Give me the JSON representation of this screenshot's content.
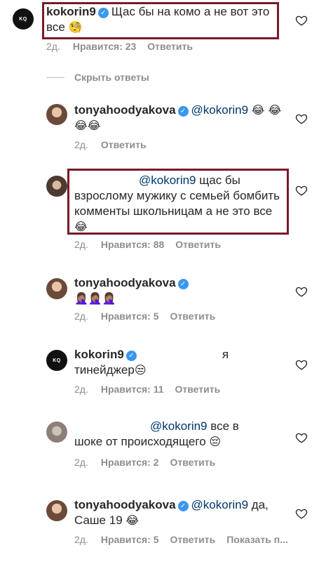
{
  "comments": [
    {
      "user": "kokorin9",
      "text": "Щас бы на комо а не вот это все",
      "emoji": "🧐",
      "time": "2д.",
      "likes": "Нравится: 23",
      "reply": "Ответить",
      "avatar": "KQ"
    },
    {
      "user": "tonyahoodyakova",
      "mention": "@kokorin9",
      "emoji": "😂 😂😂😂",
      "time": "2д.",
      "reply": "Ответить"
    },
    {
      "mention": "@kokorin9",
      "text": "щас бы взрослому мужику с семьей бомбить комменты школьницам а не это все",
      "emoji": "😂",
      "time": "2д.",
      "likes": "Нравится: 88",
      "reply": "Ответить"
    },
    {
      "user": "tonyahoodyakova",
      "emoji": "🤦🏽‍♀️🤦🏽‍♀️🤦🏽‍♀️",
      "time": "2д.",
      "likes": "Нравится: 5",
      "reply": "Ответить"
    },
    {
      "user": "kokorin9",
      "text_a": "я",
      "text_b": "тинейджер",
      "emoji": "😒",
      "time": "2д.",
      "likes": "Нравится: 11",
      "reply": "Ответить",
      "avatar": "KQ"
    },
    {
      "mention": "@kokorin9",
      "text_a": "все в",
      "text_b": "шоке от происходящего",
      "emoji": "😔",
      "time": "2д.",
      "likes": "Нравится: 2",
      "reply": "Ответить"
    },
    {
      "user": "tonyahoodyakova",
      "mention": "@kokorin9",
      "text_a": "да,",
      "text_b": "Саше 19",
      "emoji": "😂",
      "time": "2д.",
      "likes": "Нравится: 5",
      "reply": "Ответить",
      "more": "Показать п..."
    }
  ],
  "hide_replies": "Скрыть ответы",
  "icons": {
    "verified": "verified-check-icon",
    "like": "heart-outline-icon"
  },
  "colors": {
    "highlight": "#7a1a28",
    "verified": "#3897f0",
    "meta": "#8e8e8e",
    "mention": "#00376b"
  }
}
